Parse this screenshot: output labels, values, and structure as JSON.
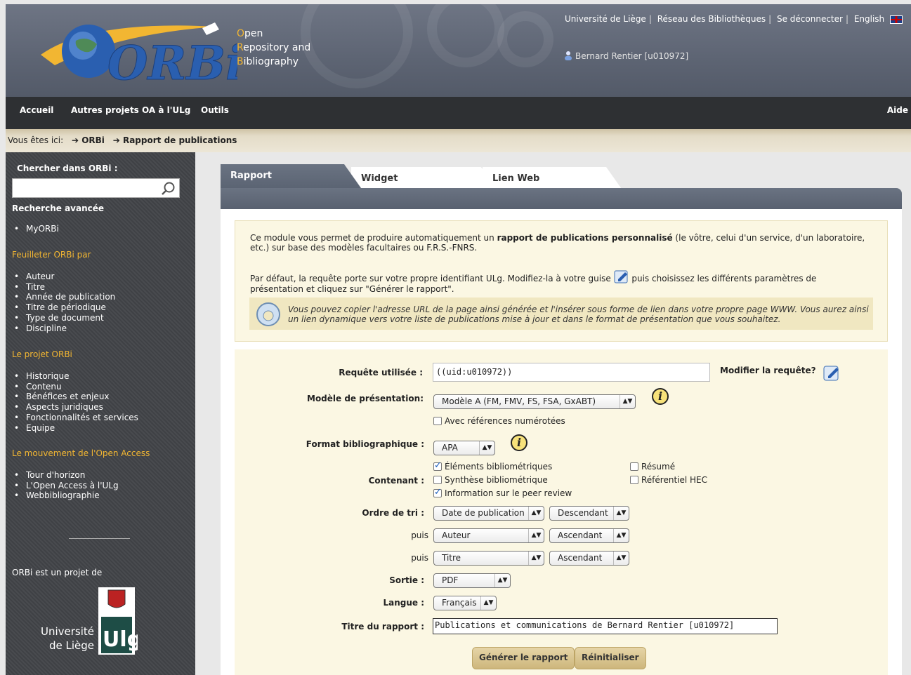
{
  "header": {
    "tagline": [
      {
        "first": "O",
        "rest": "pen"
      },
      {
        "first": "R",
        "rest": "epository and"
      },
      {
        "first": "B",
        "rest": "ibliography"
      }
    ],
    "logo_text": "ORBi",
    "links": [
      "Université de Liège",
      "Réseau des Bibliothèques",
      "Se déconnecter",
      "English"
    ],
    "user": "Bernard Rentier [u010972]"
  },
  "nav": {
    "items": [
      "Accueil",
      "Autres projets OA à l'ULg",
      "Outils"
    ],
    "help": "Aide"
  },
  "breadcrumb": {
    "prefix": "Vous êtes ici:",
    "items": [
      "ORBi",
      "Rapport de publications"
    ]
  },
  "sidebar": {
    "search_title": "Chercher dans ORBi :",
    "search_placeholder": "",
    "advanced": "Recherche avancée",
    "myorbi": [
      "MyORBi"
    ],
    "browse_title": "Feuilleter ORBi par",
    "browse": [
      "Auteur",
      "Titre",
      "Année de publication",
      "Titre de périodique",
      "Type de document",
      "Discipline"
    ],
    "project_title": "Le projet ORBi",
    "project": [
      "Historique",
      "Contenu",
      "Bénéfices et enjeux",
      "Aspects juridiques",
      "Fonctionnalités et services",
      "Equipe"
    ],
    "oa_title": "Le mouvement de l'Open Access",
    "oa": [
      "Tour d'horizon",
      "L'Open Access à l'ULg",
      "Webbibliographie"
    ],
    "project_of": "ORBi est un projet de",
    "university": [
      "Université",
      "de Liège"
    ],
    "ulg": "Ulg"
  },
  "tabs": [
    "Rapport",
    "Widget",
    "Lien Web"
  ],
  "intro": {
    "p1_a": "Ce module vous permet de produire automatiquement un ",
    "p1_b": "rapport de publications personnalisé",
    "p1_c": " (le vôtre, celui d'un service, d'un laboratoire,",
    "p1_d": "etc.) sur base des modèles facultaires ou F.R.S.-FNRS.",
    "p2_a": "Par défaut, la requête porte sur votre propre identifiant ULg. Modifiez-la à votre guise",
    "p2_b": " puis choisissez les différents paramètres de",
    "p2_c": "présentation et cliquez sur \"Générer le rapport\".",
    "note_1": "Vous pouvez copier l'adresse URL de la page ainsi générée et l'insérer sous forme de lien dans votre propre page WWW. Vous aurez ainsi",
    "note_2": "un lien dynamique vers votre liste de publications mise à jour et dans le format de présentation que vous souhaitez."
  },
  "form": {
    "query_label": "Requête utilisée :",
    "query_value": "((uid:u010972))",
    "modify_label": "Modifier la requête?",
    "model_label": "Modèle de présentation:",
    "model_value": "Modèle A (FM, FMV, FS, FSA, GxABT)",
    "numbered_label": "Avec références numérotées",
    "format_label": "Format bibliographique :",
    "format_value": "APA",
    "content_label": "Contenant :",
    "content_options": [
      {
        "label": "Éléments bibliométriques",
        "checked": true
      },
      {
        "label": "Synthèse bibliométrique",
        "checked": false
      },
      {
        "label": "Information sur le peer review",
        "checked": true
      },
      {
        "label": "Résumé",
        "checked": false
      },
      {
        "label": "Référentiel HEC",
        "checked": false
      }
    ],
    "sort_label": "Ordre de tri :",
    "then_label": "puis",
    "sort": [
      {
        "field": "Date de publication",
        "dir": "Descendant"
      },
      {
        "field": "Auteur",
        "dir": "Ascendant"
      },
      {
        "field": "Titre",
        "dir": "Ascendant"
      }
    ],
    "output_label": "Sortie :",
    "output_value": "PDF",
    "language_label": "Langue :",
    "language_value": "Français",
    "title_label": "Titre du rapport :",
    "title_value": "Publications et communications de Bernard Rentier [u010972]",
    "generate_button": "Générer le rapport",
    "reset_button": "Réinitialiser"
  },
  "colors": {
    "accent": "#f2b632",
    "nav": "#2e3033",
    "form_bg": "#fbf7e3"
  }
}
